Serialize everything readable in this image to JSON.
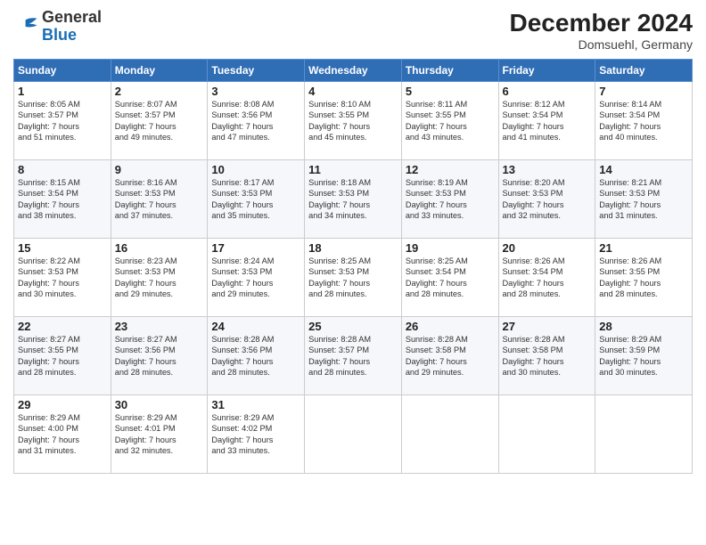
{
  "header": {
    "logo_general": "General",
    "logo_blue": "Blue",
    "month_title": "December 2024",
    "location": "Domsuehl, Germany"
  },
  "days_of_week": [
    "Sunday",
    "Monday",
    "Tuesday",
    "Wednesday",
    "Thursday",
    "Friday",
    "Saturday"
  ],
  "weeks": [
    [
      {
        "day": "1",
        "sunrise": "8:05 AM",
        "sunset": "3:57 PM",
        "daylight": "7 hours and 51 minutes."
      },
      {
        "day": "2",
        "sunrise": "8:07 AM",
        "sunset": "3:57 PM",
        "daylight": "7 hours and 49 minutes."
      },
      {
        "day": "3",
        "sunrise": "8:08 AM",
        "sunset": "3:56 PM",
        "daylight": "7 hours and 47 minutes."
      },
      {
        "day": "4",
        "sunrise": "8:10 AM",
        "sunset": "3:55 PM",
        "daylight": "7 hours and 45 minutes."
      },
      {
        "day": "5",
        "sunrise": "8:11 AM",
        "sunset": "3:55 PM",
        "daylight": "7 hours and 43 minutes."
      },
      {
        "day": "6",
        "sunrise": "8:12 AM",
        "sunset": "3:54 PM",
        "daylight": "7 hours and 41 minutes."
      },
      {
        "day": "7",
        "sunrise": "8:14 AM",
        "sunset": "3:54 PM",
        "daylight": "7 hours and 40 minutes."
      }
    ],
    [
      {
        "day": "8",
        "sunrise": "8:15 AM",
        "sunset": "3:54 PM",
        "daylight": "7 hours and 38 minutes."
      },
      {
        "day": "9",
        "sunrise": "8:16 AM",
        "sunset": "3:53 PM",
        "daylight": "7 hours and 37 minutes."
      },
      {
        "day": "10",
        "sunrise": "8:17 AM",
        "sunset": "3:53 PM",
        "daylight": "7 hours and 35 minutes."
      },
      {
        "day": "11",
        "sunrise": "8:18 AM",
        "sunset": "3:53 PM",
        "daylight": "7 hours and 34 minutes."
      },
      {
        "day": "12",
        "sunrise": "8:19 AM",
        "sunset": "3:53 PM",
        "daylight": "7 hours and 33 minutes."
      },
      {
        "day": "13",
        "sunrise": "8:20 AM",
        "sunset": "3:53 PM",
        "daylight": "7 hours and 32 minutes."
      },
      {
        "day": "14",
        "sunrise": "8:21 AM",
        "sunset": "3:53 PM",
        "daylight": "7 hours and 31 minutes."
      }
    ],
    [
      {
        "day": "15",
        "sunrise": "8:22 AM",
        "sunset": "3:53 PM",
        "daylight": "7 hours and 30 minutes."
      },
      {
        "day": "16",
        "sunrise": "8:23 AM",
        "sunset": "3:53 PM",
        "daylight": "7 hours and 29 minutes."
      },
      {
        "day": "17",
        "sunrise": "8:24 AM",
        "sunset": "3:53 PM",
        "daylight": "7 hours and 29 minutes."
      },
      {
        "day": "18",
        "sunrise": "8:25 AM",
        "sunset": "3:53 PM",
        "daylight": "7 hours and 28 minutes."
      },
      {
        "day": "19",
        "sunrise": "8:25 AM",
        "sunset": "3:54 PM",
        "daylight": "7 hours and 28 minutes."
      },
      {
        "day": "20",
        "sunrise": "8:26 AM",
        "sunset": "3:54 PM",
        "daylight": "7 hours and 28 minutes."
      },
      {
        "day": "21",
        "sunrise": "8:26 AM",
        "sunset": "3:55 PM",
        "daylight": "7 hours and 28 minutes."
      }
    ],
    [
      {
        "day": "22",
        "sunrise": "8:27 AM",
        "sunset": "3:55 PM",
        "daylight": "7 hours and 28 minutes."
      },
      {
        "day": "23",
        "sunrise": "8:27 AM",
        "sunset": "3:56 PM",
        "daylight": "7 hours and 28 minutes."
      },
      {
        "day": "24",
        "sunrise": "8:28 AM",
        "sunset": "3:56 PM",
        "daylight": "7 hours and 28 minutes."
      },
      {
        "day": "25",
        "sunrise": "8:28 AM",
        "sunset": "3:57 PM",
        "daylight": "7 hours and 28 minutes."
      },
      {
        "day": "26",
        "sunrise": "8:28 AM",
        "sunset": "3:58 PM",
        "daylight": "7 hours and 29 minutes."
      },
      {
        "day": "27",
        "sunrise": "8:28 AM",
        "sunset": "3:58 PM",
        "daylight": "7 hours and 30 minutes."
      },
      {
        "day": "28",
        "sunrise": "8:29 AM",
        "sunset": "3:59 PM",
        "daylight": "7 hours and 30 minutes."
      }
    ],
    [
      {
        "day": "29",
        "sunrise": "8:29 AM",
        "sunset": "4:00 PM",
        "daylight": "7 hours and 31 minutes."
      },
      {
        "day": "30",
        "sunrise": "8:29 AM",
        "sunset": "4:01 PM",
        "daylight": "7 hours and 32 minutes."
      },
      {
        "day": "31",
        "sunrise": "8:29 AM",
        "sunset": "4:02 PM",
        "daylight": "7 hours and 33 minutes."
      },
      null,
      null,
      null,
      null
    ]
  ],
  "labels": {
    "sunrise": "Sunrise:",
    "sunset": "Sunset:",
    "daylight": "Daylight hours"
  }
}
